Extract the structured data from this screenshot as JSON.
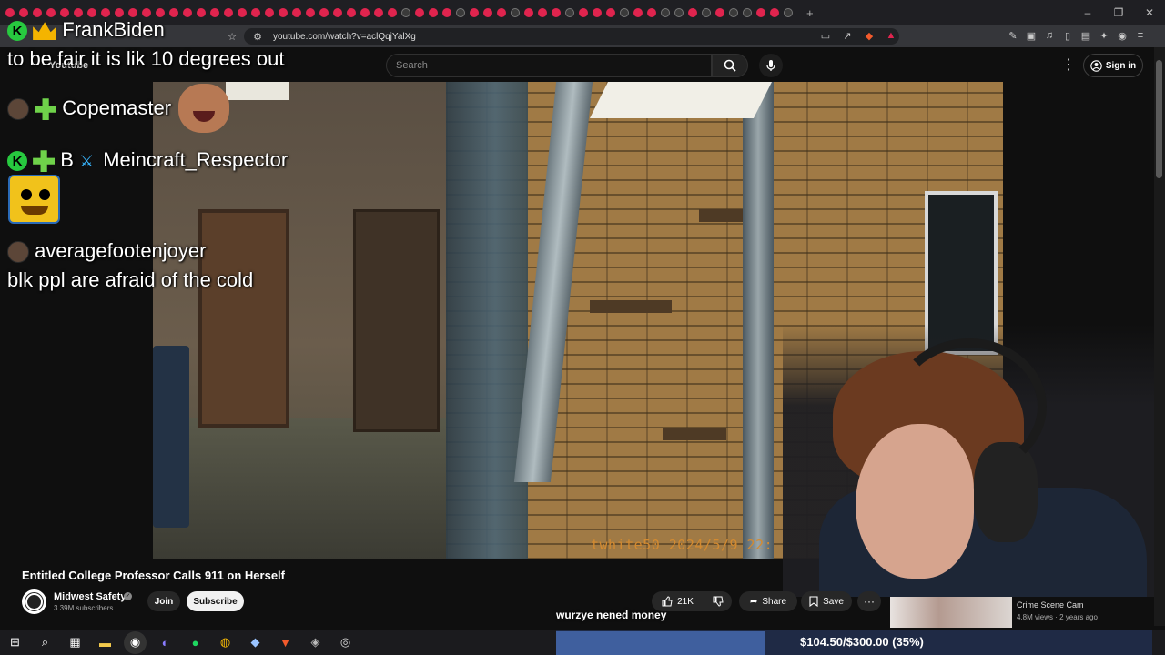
{
  "browser": {
    "url": "youtube.com/watch?v=aclQqjYalXg",
    "tab_count_visible": 58,
    "window_controls": [
      "–",
      "❐",
      "✕"
    ]
  },
  "youtube": {
    "logo_text": "Youtube",
    "search_placeholder": "Search",
    "sign_in_label": "Sign in",
    "video": {
      "title": "Entitled College Professor Calls 911 on Herself",
      "watermark": "twhite50  2024/5/9  22:",
      "channel_name": "Midwest Safety",
      "subscribers": "3.39M subscribers",
      "join_label": "Join",
      "subscribe_label": "Subscribe",
      "likes": "21K",
      "share_label": "Share",
      "save_label": "Save",
      "more_label": "···"
    },
    "recommendation": {
      "title": "Crime Scene Cam",
      "meta": "4.8M views · 2 years ago"
    }
  },
  "stream_overlay": {
    "chat": [
      {
        "user": "FrankBiden",
        "badges": [
          "kick-badge",
          "crown-icon"
        ]
      },
      {
        "message": "to be fair it is lik 10 degrees out"
      },
      {
        "user": "Copemaster",
        "badges": [
          "avatar",
          "plus-badge"
        ]
      },
      {
        "user": "Meincraft_Respector",
        "badges": [
          "kick-badge",
          "plus-badge",
          "B",
          "sword-icon"
        ]
      },
      {
        "user": "averagefootenjoyer",
        "badges": [
          "avatar"
        ]
      },
      {
        "message": "blk ppl are afraid of the cold"
      }
    ],
    "donation_message": "wurzye nened money",
    "goal": {
      "text": "$104.50/$300.00 (35%)",
      "progress": 0.35
    }
  },
  "taskbar": {
    "icons": [
      "windows-start-icon",
      "search-icon",
      "task-view-icon",
      "file-explorer-icon",
      "obs-icon",
      "discord-icon",
      "spotify-icon",
      "chrome-icon",
      "steam-icon",
      "brave-icon",
      "app-icon",
      "app-icon-2"
    ]
  },
  "colors": {
    "accent_red": "#e0244e",
    "kick_green": "#27c93f",
    "goal_fill": "#3f5f9e",
    "watermark": "#d38a30"
  }
}
